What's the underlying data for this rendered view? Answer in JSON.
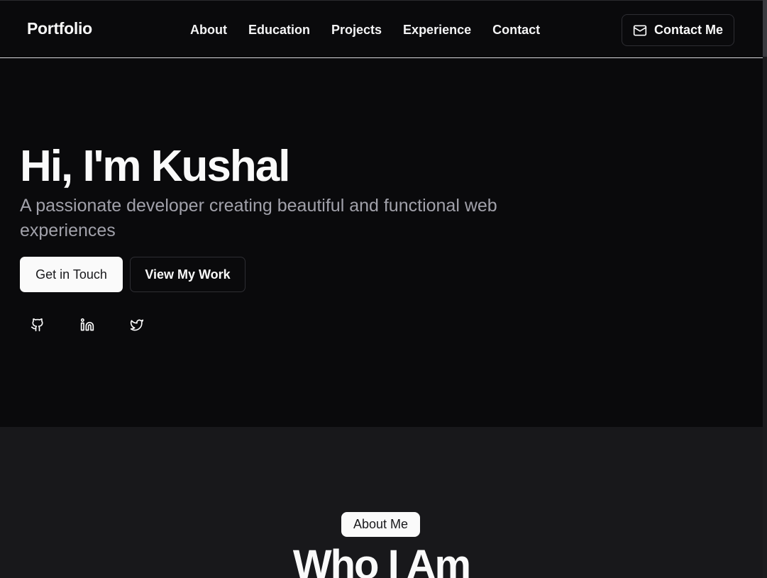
{
  "header": {
    "logo": "Portfolio",
    "nav": [
      "About",
      "Education",
      "Projects",
      "Experience",
      "Contact"
    ],
    "contact_button": "Contact Me",
    "contact_icon": "mail-icon"
  },
  "hero": {
    "title": "Hi, I'm Kushal",
    "subtitle": "A passionate developer creating beautiful and functional web experiences",
    "primary_button": "Get in Touch",
    "secondary_button": "View My Work",
    "socials": [
      "github-icon",
      "linkedin-icon",
      "twitter-icon"
    ]
  },
  "about": {
    "badge": "About Me",
    "title": "Who I Am"
  },
  "colors": {
    "background": "#0a0a0c",
    "section_alt": "#18181b",
    "text": "#fafafa",
    "muted": "#a1a1aa",
    "border": "#2e2e33"
  }
}
